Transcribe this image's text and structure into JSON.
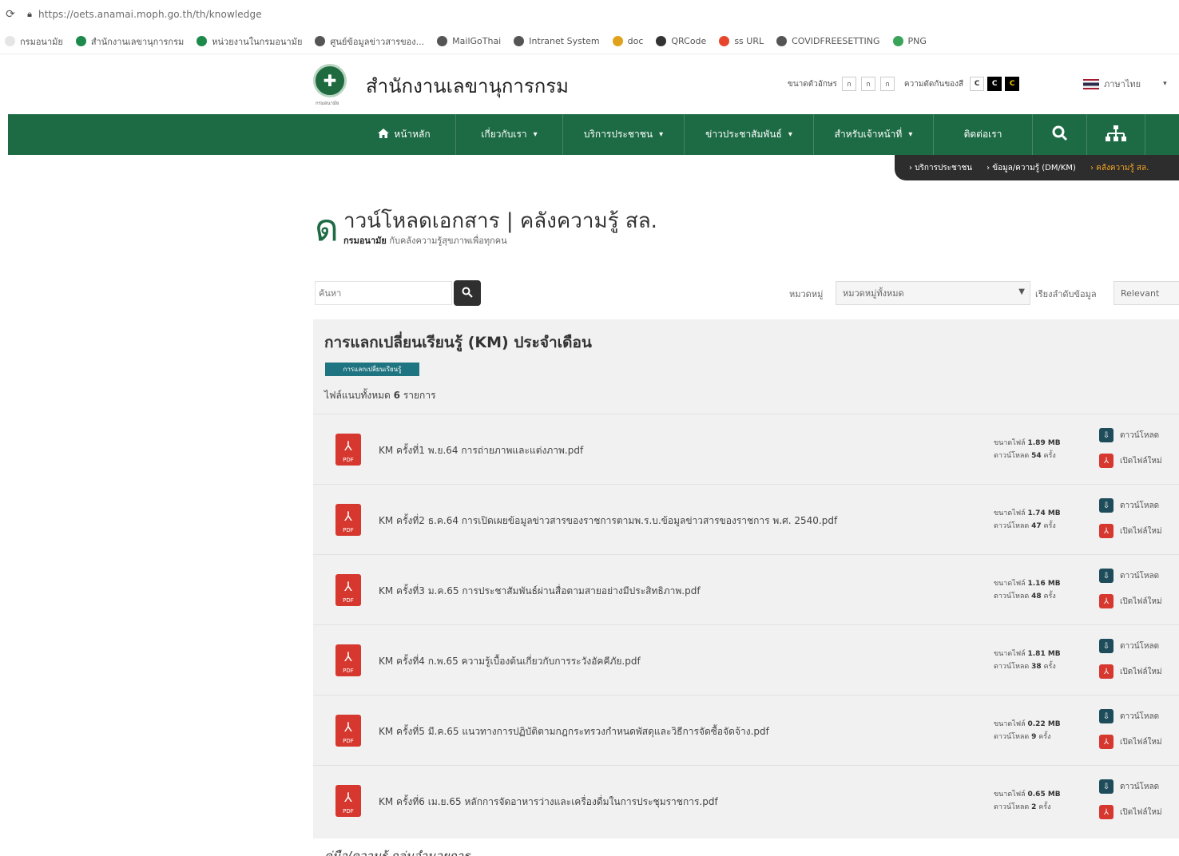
{
  "browser": {
    "url": "https://oets.anamai.moph.go.th/th/knowledge",
    "bookmarks": [
      {
        "label": "กรมอนามัย",
        "color": "#e5e5e5"
      },
      {
        "label": "สำนักงานเลขานุการกรม",
        "color": "#1d8a4b"
      },
      {
        "label": "หน่วยงานในกรมอนามัย",
        "color": "#1d8a4b"
      },
      {
        "label": "ศูนย์ข้อมูลข่าวสารของ...",
        "color": "#555555"
      },
      {
        "label": "MailGoThai",
        "color": "#555555"
      },
      {
        "label": "Intranet System",
        "color": "#555555"
      },
      {
        "label": "doc",
        "color": "#e0a21c"
      },
      {
        "label": "QRCode",
        "color": "#333333"
      },
      {
        "label": "ss URL",
        "color": "#e8452d"
      },
      {
        "label": "COVIDFREESETTING",
        "color": "#555555"
      },
      {
        "label": "PNG",
        "color": "#3aa35a"
      }
    ]
  },
  "header": {
    "site_title": "สำนักงานเลขานุการกรม",
    "logo_caption": "กรมอนามัย",
    "font_size_label": "ขนาดตัวอักษร",
    "font_sizes": [
      "ก",
      "ก",
      "ก"
    ],
    "contrast_label": "ความตัดกันของสี",
    "contrast": [
      "C",
      "C",
      "C"
    ],
    "language": "ภาษาไทย"
  },
  "nav": {
    "items": [
      {
        "label": "หน้าหลัก",
        "icon": "home-icon",
        "caret": false
      },
      {
        "label": "เกี่ยวกับเรา",
        "caret": true
      },
      {
        "label": "บริการประชาชน",
        "caret": true
      },
      {
        "label": "ข่าวประชาสัมพันธ์",
        "caret": true
      },
      {
        "label": "สำหรับเจ้าหน้าที่",
        "caret": true
      },
      {
        "label": "ติดต่อเรา",
        "caret": false
      }
    ]
  },
  "breadcrumb": {
    "items": [
      "บริการประชาชน",
      "ข้อมูล/ความรู้ (DM/KM)",
      "คลังความรู้ สล."
    ]
  },
  "page": {
    "title": "าวน์โหลดเอกสาร | คลังความรู้ สล.",
    "title_initial": "ด",
    "subtitle_bold": "กรมอนามัย",
    "subtitle": "กับคลังความรู้สุขภาพเพื่อทุกคน"
  },
  "filters": {
    "search_placeholder": "ค้นหา",
    "category_label": "หมวดหมู่",
    "category_value": "หมวดหมู่ทั้งหมด",
    "sort_label": "เรียงลำดับข้อมูล",
    "sort_value": "Relevant"
  },
  "panel": {
    "title": "การแลกเปลี่ยนเรียนรู้ (KM) ประจำเดือน",
    "tag": "การแลกเปลี่ยนเรียนรู้",
    "count_prefix": "ไฟล์แนบทั้งหมด",
    "count_value": "6",
    "count_suffix": "รายการ",
    "size_label": "ขนาดไฟล์",
    "views_label": "ดาวน์โหลด",
    "times_label": "ครั้ง",
    "view_label": "ดาวน์โหลด",
    "download_label": "เปิดไฟล์ใหม่",
    "files": [
      {
        "name": "KM ครั้งที่1 พ.ย.64 การถ่ายภาพและแต่งภาพ.pdf",
        "size": "1.89 MB",
        "downloads": "54"
      },
      {
        "name": "KM ครั้งที่2 ธ.ค.64 การเปิดเผยข้อมูลข่าวสารของราชการตามพ.ร.บ.ข้อมูลข่าวสารของราชการ พ.ศ. 2540.pdf",
        "size": "1.74 MB",
        "downloads": "47"
      },
      {
        "name": "KM ครั้งที่3 ม.ค.65 การประชาสัมพันธ์ผ่านสื่อตามสายอย่างมีประสิทธิภาพ.pdf",
        "size": "1.16 MB",
        "downloads": "48"
      },
      {
        "name": "KM ครั้งที่4 ก.พ.65 ความรู้เบื้องต้นเกี่ยวกับการระวังอัคคีภัย.pdf",
        "size": "1.81 MB",
        "downloads": "38"
      },
      {
        "name": "KM ครั้งที่5 มี.ค.65 แนวทางการปฏิบัติตามกฎกระทรวงกำหนดพัสดุและวิธีการจัดซื้อจัดจ้าง.pdf",
        "size": "0.22 MB",
        "downloads": "9"
      },
      {
        "name": "KM ครั้งที่6 เม.ย.65 หลักการจัดอาหารว่างและเครื่องดื่มในการประชุมราชการ.pdf",
        "size": "0.65 MB",
        "downloads": "2"
      }
    ]
  },
  "footer_cut": "คู่มือ/ความรู้ กลุ่มอำนวยการ",
  "colors": {
    "brand_green": "#1d6b45",
    "pdf_red": "#d6382f",
    "tag_teal": "#1e7480"
  }
}
